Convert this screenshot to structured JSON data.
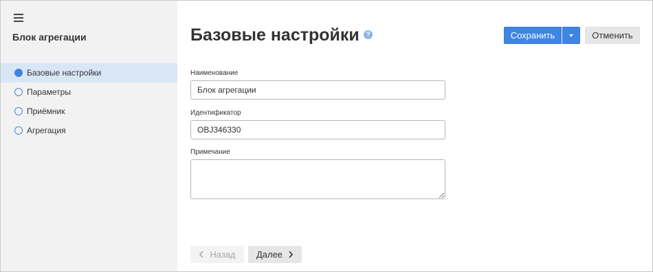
{
  "sidebar": {
    "menu_icon": "hamburger-menu-icon",
    "title": "Блок агрегации",
    "items": [
      {
        "label": "Базовые настройки",
        "active": true
      },
      {
        "label": "Параметры",
        "active": false
      },
      {
        "label": "Приёмник",
        "active": false
      },
      {
        "label": "Агрегация",
        "active": false
      }
    ]
  },
  "header": {
    "title": "Базовые настройки",
    "help_icon": "help-question-icon",
    "help_glyph": "?",
    "save_label": "Сохранить",
    "cancel_label": "Отменить"
  },
  "form": {
    "name_label": "Наименование",
    "name_value": "Блок агрегации",
    "id_label": "Идентификатор",
    "id_value": "OBJ346330",
    "note_label": "Примечание",
    "note_value": ""
  },
  "footer": {
    "back_label": "Назад",
    "next_label": "Далее"
  },
  "colors": {
    "accent": "#3f86e3",
    "sidebar_bg": "#f2f2f2",
    "active_item_bg": "#d9e6f6"
  }
}
